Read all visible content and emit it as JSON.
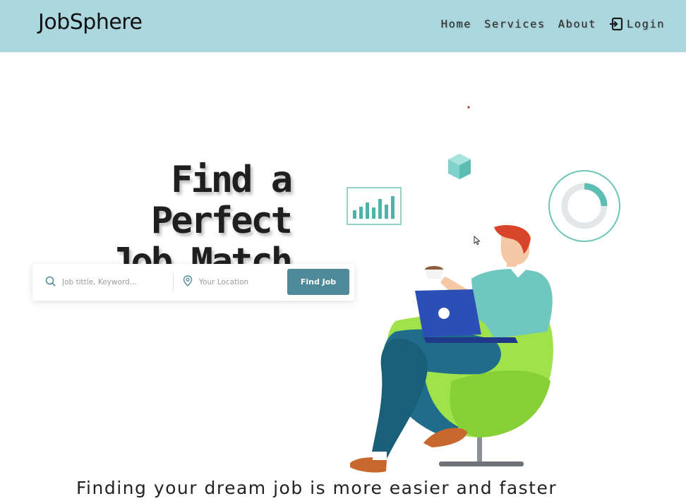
{
  "navbar": {
    "brand": "JobSphere",
    "links": [
      "Home",
      "Services",
      "About"
    ],
    "login_label": "Login",
    "background": "#acd7de"
  },
  "hero": {
    "title_line1": "Find a Perfect",
    "title_line2": "Job Match"
  },
  "search": {
    "keyword_placeholder": "Job tittle, Keyword...",
    "location_placeholder": "Your Location",
    "button_label": "Find Job",
    "button_color": "#4f8a98"
  },
  "icons": {
    "keyword": "search-icon",
    "location": "map-pin-icon",
    "login": "login-arrow-icon"
  },
  "tagline": "Finding your dream job is more easier and faster",
  "colors": {
    "accent": "#6cc5b8",
    "chair": "#9fe24a",
    "sweater": "#6fc7c0",
    "pants": "#1f6d8a",
    "laptop": "#2c4fb5",
    "hair": "#d9452b"
  }
}
